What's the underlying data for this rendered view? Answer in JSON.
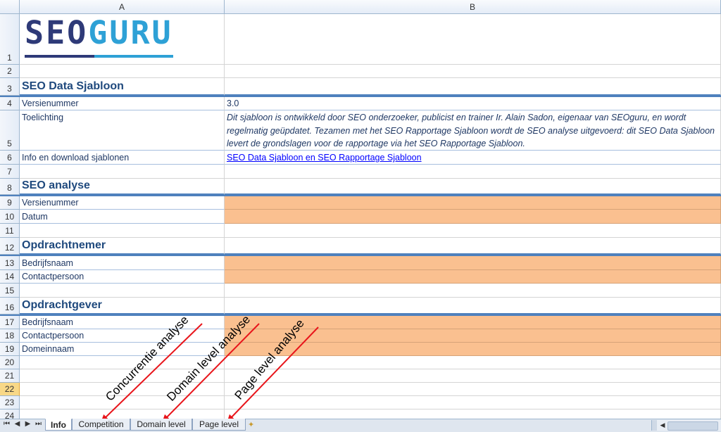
{
  "columns": [
    "A",
    "B"
  ],
  "logo": {
    "part1": "SEO",
    "part2": "GURU"
  },
  "rows": {
    "r1": "1",
    "r2": "2",
    "r3": "3",
    "r4": "4",
    "r5": "5",
    "r6": "6",
    "r7": "7",
    "r8": "8",
    "r9": "9",
    "r10": "10",
    "r11": "11",
    "r12": "12",
    "r13": "13",
    "r14": "14",
    "r15": "15",
    "r16": "16",
    "r17": "17",
    "r18": "18",
    "r19": "19",
    "r20": "20",
    "r21": "21",
    "r22": "22",
    "r23": "23",
    "r24": "24"
  },
  "cells": {
    "a3": "SEO Data Sjabloon",
    "a4": "Versienummer",
    "b4": "3.0",
    "a5": "Toelichting",
    "b5": "Dit sjabloon is ontwikkeld door SEO onderzoeker, publicist en trainer Ir. Alain Sadon, eigenaar van SEOguru, en wordt regelmatig geüpdatet. Tezamen met het SEO Rapportage Sjabloon wordt de SEO analyse uitgevoerd: dit SEO Data Sjabloon levert de grondslagen voor de rapportage via het SEO Rapportage Sjabloon.",
    "a6": "Info en download sjablonen",
    "b6": "SEO Data Sjabloon en SEO Rapportage Sjabloon",
    "a8": "SEO analyse",
    "a9": "Versienummer",
    "a10": "Datum",
    "a12": "Opdrachtnemer",
    "a13": "Bedrijfsnaam",
    "a14": "Contactpersoon",
    "a16": "Opdrachtgever",
    "a17": "Bedrijfsnaam",
    "a18": "Contactpersoon",
    "a19": "Domeinnaam"
  },
  "annotations": {
    "concurrentie": "Concurrentie analyse",
    "domain": "Domain level analyse",
    "page": "Page level analyse",
    "arrow_color": "#e8151b"
  },
  "tabs": [
    "Info",
    "Competition",
    "Domain level",
    "Page level"
  ],
  "active_tab": "Info",
  "colors": {
    "fill": "#fac090",
    "header_rule": "#4f81bd",
    "heading_text": "#1f497d"
  }
}
